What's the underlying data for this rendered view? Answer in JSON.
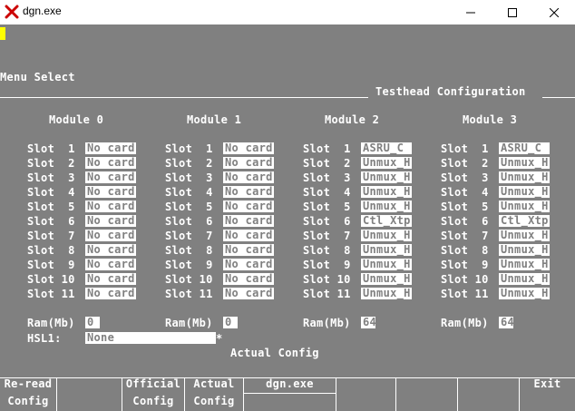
{
  "window": {
    "title": "dgn.exe"
  },
  "menu_select": "Menu Select",
  "section_title": "Testhead Configuration",
  "modules": [
    {
      "title": "Module 0",
      "slots": [
        {
          "label": "Slot  1",
          "value": "No card"
        },
        {
          "label": "Slot  2",
          "value": "No card"
        },
        {
          "label": "Slot  3",
          "value": "No card"
        },
        {
          "label": "Slot  4",
          "value": "No card"
        },
        {
          "label": "Slot  5",
          "value": "No card"
        },
        {
          "label": "Slot  6",
          "value": "No card"
        },
        {
          "label": "Slot  7",
          "value": "No card"
        },
        {
          "label": "Slot  8",
          "value": "No card"
        },
        {
          "label": "Slot  9",
          "value": "No card"
        },
        {
          "label": "Slot 10",
          "value": "No card"
        },
        {
          "label": "Slot 11",
          "value": "No card"
        }
      ],
      "ram_label": "Ram(Mb)",
      "ram": "0"
    },
    {
      "title": "Module 1",
      "slots": [
        {
          "label": "Slot  1",
          "value": "No card"
        },
        {
          "label": "Slot  2",
          "value": "No card"
        },
        {
          "label": "Slot  3",
          "value": "No card"
        },
        {
          "label": "Slot  4",
          "value": "No card"
        },
        {
          "label": "Slot  5",
          "value": "No card"
        },
        {
          "label": "Slot  6",
          "value": "No card"
        },
        {
          "label": "Slot  7",
          "value": "No card"
        },
        {
          "label": "Slot  8",
          "value": "No card"
        },
        {
          "label": "Slot  9",
          "value": "No card"
        },
        {
          "label": "Slot 10",
          "value": "No card"
        },
        {
          "label": "Slot 11",
          "value": "No card"
        }
      ],
      "ram_label": "Ram(Mb)",
      "ram": "0"
    },
    {
      "title": "Module 2",
      "slots": [
        {
          "label": "Slot  1",
          "value": "ASRU_C"
        },
        {
          "label": "Slot  2",
          "value": "Unmux_H"
        },
        {
          "label": "Slot  3",
          "value": "Unmux_H"
        },
        {
          "label": "Slot  4",
          "value": "Unmux_H"
        },
        {
          "label": "Slot  5",
          "value": "Unmux_H"
        },
        {
          "label": "Slot  6",
          "value": "Ctl_Xtp"
        },
        {
          "label": "Slot  7",
          "value": "Unmux_H"
        },
        {
          "label": "Slot  8",
          "value": "Unmux_H"
        },
        {
          "label": "Slot  9",
          "value": "Unmux_H"
        },
        {
          "label": "Slot 10",
          "value": "Unmux_H"
        },
        {
          "label": "Slot 11",
          "value": "Unmux_H"
        }
      ],
      "ram_label": "Ram(Mb)",
      "ram": "64"
    },
    {
      "title": "Module 3",
      "slots": [
        {
          "label": "Slot  1",
          "value": "ASRU_C"
        },
        {
          "label": "Slot  2",
          "value": "Unmux_H"
        },
        {
          "label": "Slot  3",
          "value": "Unmux_H"
        },
        {
          "label": "Slot  4",
          "value": "Unmux_H"
        },
        {
          "label": "Slot  5",
          "value": "Unmux_H"
        },
        {
          "label": "Slot  6",
          "value": "Ctl_Xtp"
        },
        {
          "label": "Slot  7",
          "value": "Unmux_H"
        },
        {
          "label": "Slot  8",
          "value": "Unmux_H"
        },
        {
          "label": "Slot  9",
          "value": "Unmux_H"
        },
        {
          "label": "Slot 10",
          "value": "Unmux_H"
        },
        {
          "label": "Slot 11",
          "value": "Unmux_H"
        }
      ],
      "ram_label": "Ram(Mb)",
      "ram": "64"
    }
  ],
  "hsl": {
    "label": "HSL1:",
    "value": "None",
    "marker": "*"
  },
  "config_status": "Actual Config",
  "softkeys": [
    {
      "line1": "Re-read",
      "line2": "Config"
    },
    {
      "line1": "",
      "line2": ""
    },
    {
      "line1": "Official",
      "line2": "Config"
    },
    {
      "line1": "Actual",
      "line2": "Config"
    },
    {
      "line1": "dgn.exe",
      "line2": ""
    },
    {
      "line1": "",
      "line2": ""
    },
    {
      "line1": "",
      "line2": ""
    },
    {
      "line1": "",
      "line2": ""
    },
    {
      "line1": "Exit",
      "line2": ""
    }
  ],
  "colors": {
    "terminal_bg": "#808080",
    "cursor": "#ffff00",
    "field_bg": "#ffffff",
    "app_icon": "#cc0000"
  }
}
